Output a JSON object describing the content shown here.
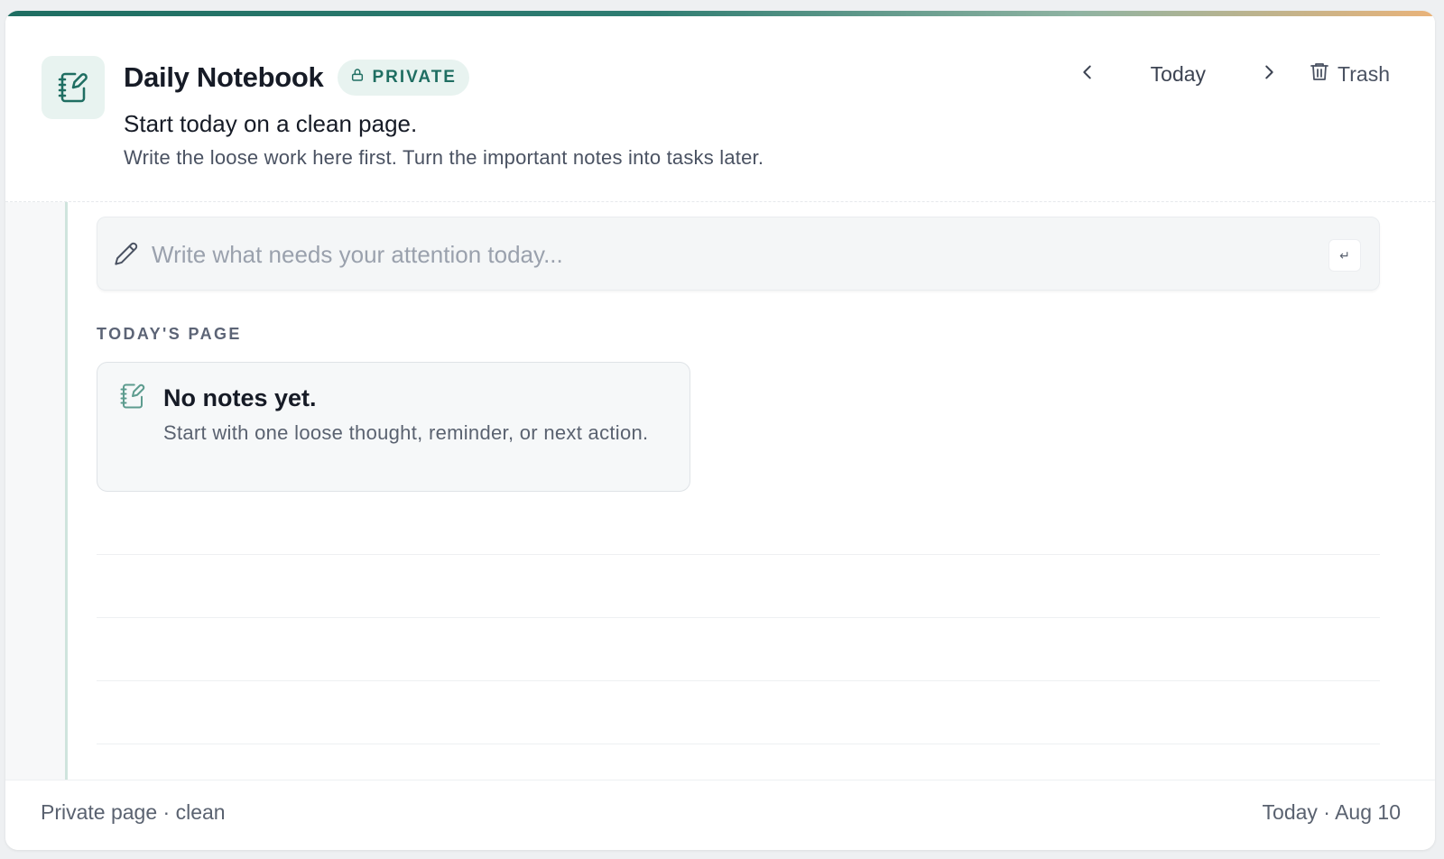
{
  "header": {
    "title": "Daily Notebook",
    "badge": "PRIVATE",
    "subtitle": "Start today on a clean page.",
    "description": "Write the loose work here first. Turn the important notes into tasks later.",
    "icon": "notebook-pen-icon"
  },
  "nav": {
    "prev_icon": "chevron-left-icon",
    "today_label": "Today",
    "next_icon": "chevron-right-icon",
    "trash_label": "Trash",
    "trash_icon": "trash-icon"
  },
  "composer": {
    "value": "",
    "placeholder": "Write what needs your attention today...",
    "icon": "pencil-icon",
    "enter_key": "↵"
  },
  "page": {
    "section_label": "TODAY'S PAGE",
    "empty_title": "No notes yet.",
    "empty_text": "Start with one loose thought, reminder, or next action."
  },
  "footer": {
    "status": "Private page · clean",
    "date": "Today · Aug 10"
  },
  "colors": {
    "accent": "#1f6e62",
    "accent_soft": "#e8f3f0",
    "gradient_end": "#e9b37a"
  }
}
